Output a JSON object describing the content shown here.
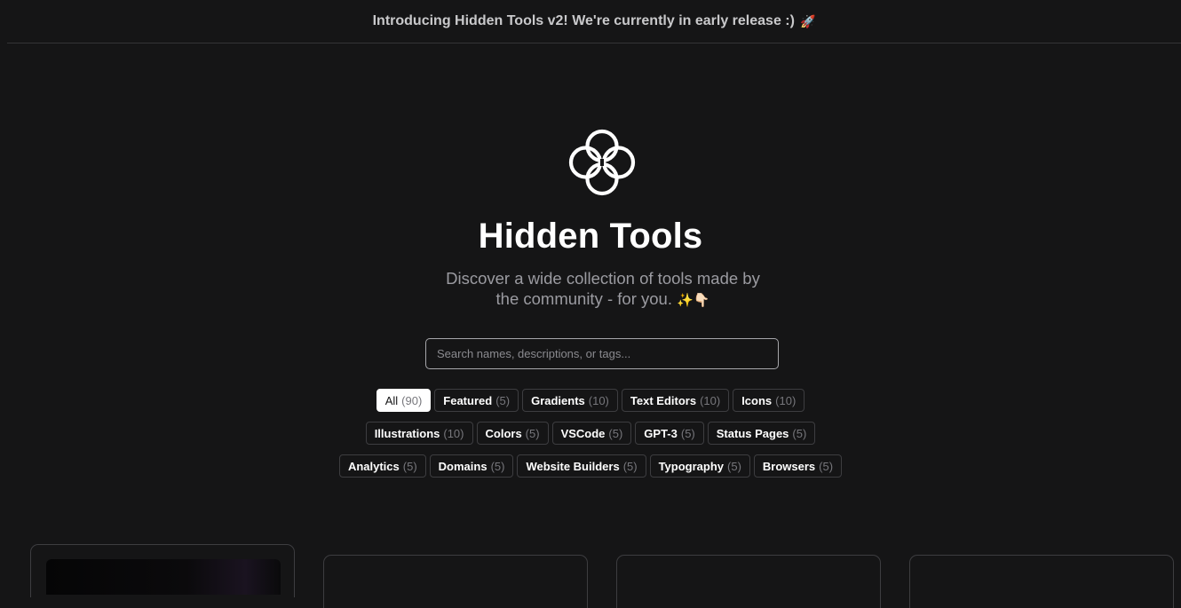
{
  "announcement": {
    "text": "Introducing Hidden Tools v2! We're currently in early release :)",
    "emoji": "🚀"
  },
  "hero": {
    "logo_icon": "interlocking-circles-icon",
    "title": "Hidden Tools",
    "subtitle_line1": "Discover a wide collection of tools made by",
    "subtitle_line2": "the community - for you.",
    "subtitle_emoji": "✨👇🏻"
  },
  "search": {
    "placeholder": "Search names, descriptions, or tags...",
    "value": ""
  },
  "filters": {
    "row1": [
      {
        "label": "All",
        "count": "(90)"
      },
      {
        "label": "Featured",
        "count": "(5)"
      },
      {
        "label": "Gradients",
        "count": "(10)"
      },
      {
        "label": "Text Editors",
        "count": "(10)"
      },
      {
        "label": "Icons",
        "count": "(10)"
      }
    ],
    "row2": [
      {
        "label": "Illustrations",
        "count": "(10)"
      },
      {
        "label": "Colors",
        "count": "(5)"
      },
      {
        "label": "VSCode",
        "count": "(5)"
      },
      {
        "label": "GPT-3",
        "count": "(5)"
      },
      {
        "label": "Status Pages",
        "count": "(5)"
      }
    ],
    "row3": [
      {
        "label": "Analytics",
        "count": "(5)"
      },
      {
        "label": "Domains",
        "count": "(5)"
      },
      {
        "label": "Website Builders",
        "count": "(5)"
      },
      {
        "label": "Typography",
        "count": "(5)"
      },
      {
        "label": "Browsers",
        "count": "(5)"
      }
    ],
    "active": "All"
  },
  "colors": {
    "background": "#151516",
    "border": "#3d3d40",
    "text": "#ffffff",
    "muted": "#9b9ba1"
  }
}
